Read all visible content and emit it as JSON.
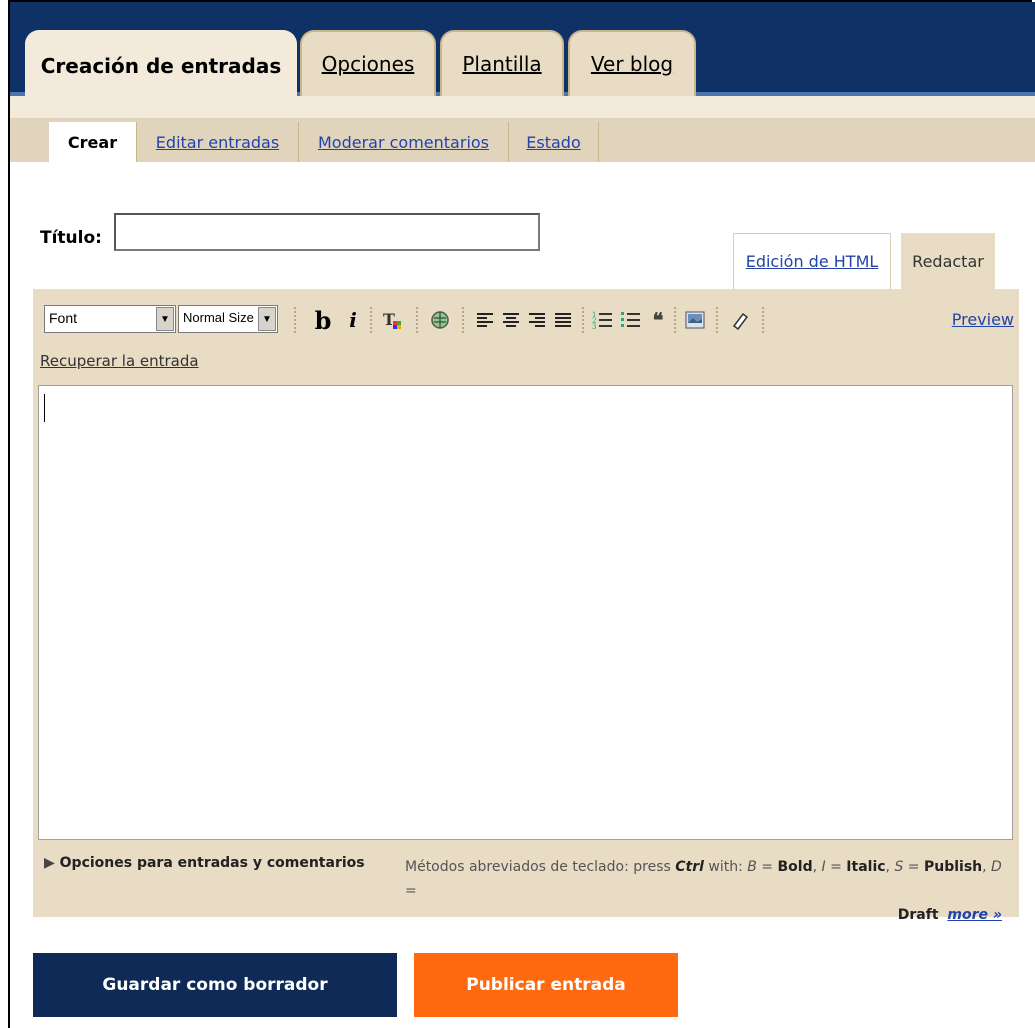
{
  "main_tabs": [
    {
      "label": "Creación de entradas",
      "active": true
    },
    {
      "label": "Opciones",
      "active": false
    },
    {
      "label": "Plantilla",
      "active": false
    },
    {
      "label": "Ver blog",
      "active": false
    }
  ],
  "sub_nav": [
    {
      "label": "Crear",
      "active": true
    },
    {
      "label": "Editar entradas",
      "active": false
    },
    {
      "label": "Moderar comentarios",
      "active": false
    },
    {
      "label": "Estado",
      "active": false
    }
  ],
  "post_title": {
    "label": "Título:",
    "value": ""
  },
  "editor_modes": {
    "html": "Edición de HTML",
    "compose": "Redactar"
  },
  "toolbar": {
    "font_select": "Font",
    "size_select": "Normal Size",
    "bold": "b",
    "italic": "i",
    "preview": "Preview",
    "icons": [
      "text-color-icon",
      "link-icon",
      "align-left-icon",
      "align-center-icon",
      "align-right-icon",
      "justify-icon",
      "numbered-list-icon",
      "bullet-list-icon",
      "blockquote-icon",
      "image-icon",
      "remove-formatting-icon"
    ]
  },
  "recover_link": "Recuperar la entrada",
  "post_body": "",
  "footer": {
    "options_link": "Opciones para entradas y comentarios",
    "shortcuts_prefix": "Métodos abreviados de teclado: press",
    "shortcuts_key": "Ctrl",
    "shortcuts_with": "with:",
    "b_key": "B",
    "b_label": "Bold",
    "i_key": "I",
    "i_label": "Italic",
    "s_key": "S",
    "s_label": "Publish",
    "d_key": "D",
    "d_label": "Draft",
    "more": "more »"
  },
  "buttons": {
    "draft": "Guardar como borrador",
    "publish": "Publicar entrada"
  },
  "colors": {
    "nav_blue": "#0f3166",
    "tab_beige": "#e8dcc4",
    "publish_orange": "#ff6a10",
    "draft_navy": "#0f2a56",
    "link_blue": "#2244aa"
  }
}
